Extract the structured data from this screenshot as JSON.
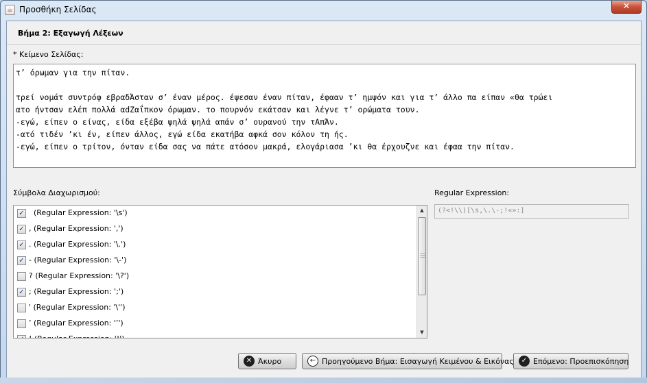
{
  "window": {
    "title": "Προσθήκη Σελίδας",
    "close_label": "✕",
    "app_icon": "java-cup-icon"
  },
  "step": {
    "title": "Βήμα 2: Εξαγωγή Λέξεων"
  },
  "page_text": {
    "required_mark": "*",
    "label": "Κείμενο Σελίδας:",
    "value": "τ’ όρωμαν για την πίταν.\n\nτρεί νομάτ συντρόφ εβραδἈσταν σ’ έναν μέρος. έψεσαν έναν πίταν, έφααν τ’ ημψόν και για τ’ άλλο πα είπαν «θα τρώει\nατο ήντσαν ελέπ πολλά αdΖαΐπκον όρωμαν. το πουρνόν εκάτσαν και λέγνε τ’ ορώματα τουν.\n-εγώ, είπεν ο είνας, είδα εξέβα ψηλά ψηλά απάν σ’ ουρανού την τΑπΆν.\n-ατό τιδέν ’κι έν, είπεν άλλος, εγώ είδα εκατήβα αφκά σον κόλον τη ής.\n-εγώ, είπεν ο τρίτον, όνταν είδα σας να πάτε ατόσον μακρά, ελογάριασα ’κι θα έρχουζνε και έφαα την πίταν."
  },
  "separators": {
    "label": "Σύμβολα Διαχωρισμού:",
    "items": [
      {
        "text": "  (Regular Expression: '\\s')",
        "checked": true
      },
      {
        "text": ", (Regular Expression: ',')",
        "checked": true
      },
      {
        "text": ". (Regular Expression: '\\.')",
        "checked": true
      },
      {
        "text": "- (Regular Expression: '\\-')",
        "checked": true
      },
      {
        "text": "? (Regular Expression: '\\?')",
        "checked": false
      },
      {
        "text": "; (Regular Expression: ';')",
        "checked": true
      },
      {
        "text": "' (Regular Expression: '\\'')",
        "checked": false
      },
      {
        "text": "’ (Regular Expression: '’')",
        "checked": false
      },
      {
        "text": "! (Regular Expression: '!')",
        "checked": true
      }
    ]
  },
  "regex": {
    "label": "Regular Expression:",
    "value": "(?<!\\\\)[\\s,\\.\\-;!«»:]"
  },
  "buttons": {
    "cancel": "Άκυρο",
    "previous": "Προηγούμενο Βήμα: Εισαγωγή Κειμένου & Εικόνας",
    "next": "Επόμενο: Προεπισκόπηση"
  }
}
